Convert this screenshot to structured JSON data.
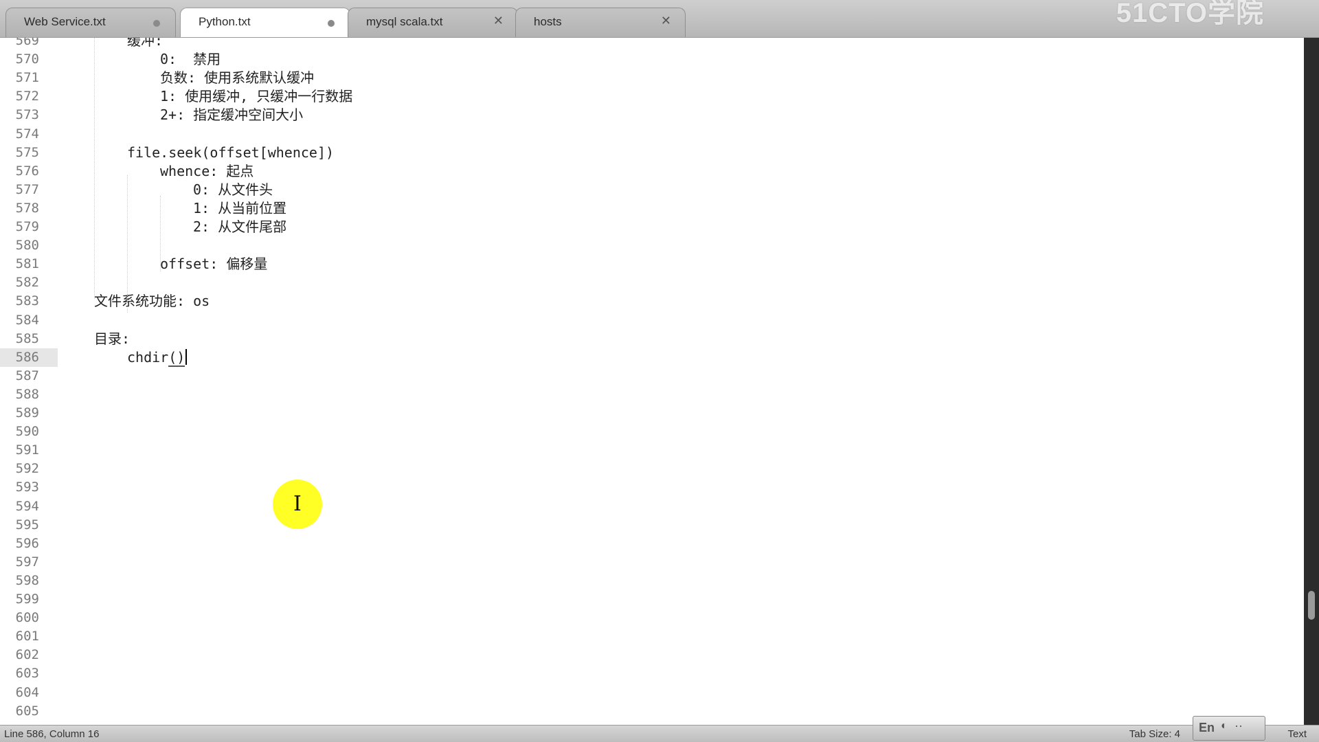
{
  "tabs": [
    {
      "label": "Web Service.txt",
      "state": "modified",
      "active": false
    },
    {
      "label": "Python.txt",
      "state": "modified",
      "active": true
    },
    {
      "label": "mysql scala.txt",
      "state": "close",
      "active": false
    },
    {
      "label": "hosts",
      "state": "close",
      "active": false
    }
  ],
  "watermark": "51CTO学院",
  "editor": {
    "lines": [
      {
        "num": "569",
        "text": "缓冲:"
      },
      {
        "num": "570",
        "text": "0:  禁用"
      },
      {
        "num": "571",
        "text": "负数: 使用系统默认缓冲"
      },
      {
        "num": "572",
        "text": "1: 使用缓冲, 只缓冲一行数据"
      },
      {
        "num": "573",
        "text": "2+: 指定缓冲空间大小"
      },
      {
        "num": "574",
        "text": ""
      },
      {
        "num": "575",
        "text": "file.seek(offset[whence])"
      },
      {
        "num": "576",
        "text": "whence: 起点"
      },
      {
        "num": "577",
        "text": "0: 从文件头"
      },
      {
        "num": "578",
        "text": "1: 从当前位置"
      },
      {
        "num": "579",
        "text": "2: 从文件尾部"
      },
      {
        "num": "580",
        "text": ""
      },
      {
        "num": "581",
        "text": "offset: 偏移量"
      },
      {
        "num": "582",
        "text": ""
      },
      {
        "num": "583",
        "text": "文件系统功能: os"
      },
      {
        "num": "584",
        "text": ""
      },
      {
        "num": "585",
        "text": "目录:"
      },
      {
        "num": "586",
        "text": "chdir()"
      },
      {
        "num": "587",
        "text": ""
      },
      {
        "num": "588",
        "text": ""
      },
      {
        "num": "589",
        "text": ""
      },
      {
        "num": "590",
        "text": ""
      },
      {
        "num": "591",
        "text": ""
      },
      {
        "num": "592",
        "text": ""
      },
      {
        "num": "593",
        "text": ""
      },
      {
        "num": "594",
        "text": ""
      },
      {
        "num": "595",
        "text": ""
      },
      {
        "num": "596",
        "text": ""
      },
      {
        "num": "597",
        "text": ""
      },
      {
        "num": "598",
        "text": ""
      },
      {
        "num": "599",
        "text": ""
      },
      {
        "num": "600",
        "text": ""
      },
      {
        "num": "601",
        "text": ""
      },
      {
        "num": "602",
        "text": ""
      },
      {
        "num": "603",
        "text": ""
      },
      {
        "num": "604",
        "text": ""
      },
      {
        "num": "605",
        "text": ""
      }
    ],
    "current_line": "586"
  },
  "status": {
    "position": "Line 586, Column 16",
    "tab_size": "Tab Size: 4",
    "syntax": "Text",
    "ime_lang": "En"
  },
  "colors": {
    "highlight": "#ffff1a",
    "current_line_gutter": "#e6e6e6"
  }
}
